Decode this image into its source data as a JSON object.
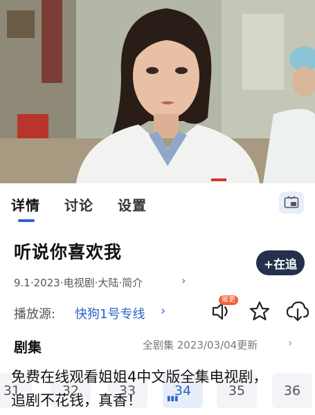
{
  "tabs": [
    {
      "label": "详情",
      "active": true
    },
    {
      "label": "讨论",
      "active": false
    },
    {
      "label": "设置",
      "active": false
    }
  ],
  "pip_icon": "picture-in-picture-icon",
  "show": {
    "title": "听说你喜欢我",
    "meta": "9.1·2023·电视剧·大陆·简介",
    "meta_arrow": "›",
    "follow_label": "+在追"
  },
  "source": {
    "label": "播放源:",
    "value": "快狗1号专线",
    "arrow": "›"
  },
  "actions": {
    "urge_badge": "催更",
    "icons": [
      "volume-icon",
      "star-icon",
      "download-icon"
    ]
  },
  "episodes": {
    "title": "剧集",
    "info": "全剧集  2023/03/04更新",
    "arrow": "›",
    "items": [
      "31",
      "32",
      "33",
      "34",
      "35",
      "36"
    ],
    "playing_index": 3
  },
  "overlay_text": {
    "line1": "免费在线观看姐姐4中文版全集电视剧，",
    "line2": "追剧不花钱，真香！"
  },
  "colors": {
    "accent": "#2a63c9",
    "follow_bg": "#25314a",
    "badge": "#f2612e"
  }
}
